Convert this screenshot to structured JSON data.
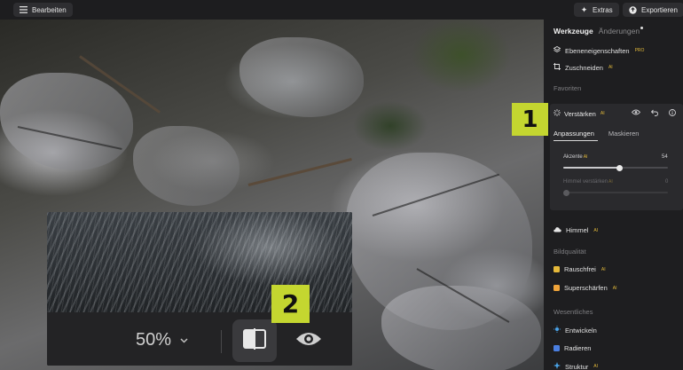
{
  "toolbar": {
    "edit_label": "Bearbeiten",
    "extras_label": "Extras",
    "export_label": "Exportieren"
  },
  "panel": {
    "tabs": [
      {
        "label": "Werkzeuge",
        "active": true
      },
      {
        "label": "Änderungen",
        "active": false
      }
    ],
    "items": {
      "layer_props": {
        "label": "Ebeneneigenschaften",
        "badge": "PRO"
      },
      "crop": {
        "label": "Zuschneiden",
        "badge": "AI"
      }
    },
    "sections": {
      "favorites": "Favoriten",
      "image_quality": "Bildqualität",
      "essentials": "Wesentliches"
    },
    "enhance_card": {
      "title": "Verstärken",
      "badge": "AI",
      "tabs": [
        {
          "label": "Anpassungen",
          "active": true
        },
        {
          "label": "Maskieren",
          "active": false
        }
      ],
      "sliders": [
        {
          "label": "Akzente",
          "badge": "AI",
          "value": "54",
          "fraction": 0.54,
          "enabled": true
        },
        {
          "label": "Himmel verstärken",
          "badge": "AI",
          "value": "0",
          "fraction": 0.0,
          "enabled": false
        }
      ]
    },
    "sky": {
      "label": "Himmel",
      "badge": "AI"
    },
    "noise": {
      "label": "Rauschfrei",
      "badge": "AI"
    },
    "sharpen": {
      "label": "Supe­rschärfen",
      "badge": "AI"
    },
    "develop": {
      "label": "Entwickeln"
    },
    "erase": {
      "label": "Radieren"
    },
    "structure": {
      "label": "Struktur",
      "badge": "AI"
    }
  },
  "compare": {
    "zoom_label": "50%"
  },
  "markers": {
    "one": "1",
    "two": "2"
  },
  "colors": {
    "accent_yellow": "#c4d630",
    "badge_gold": "#e1b83a",
    "panel_bg": "#1e1e20"
  }
}
